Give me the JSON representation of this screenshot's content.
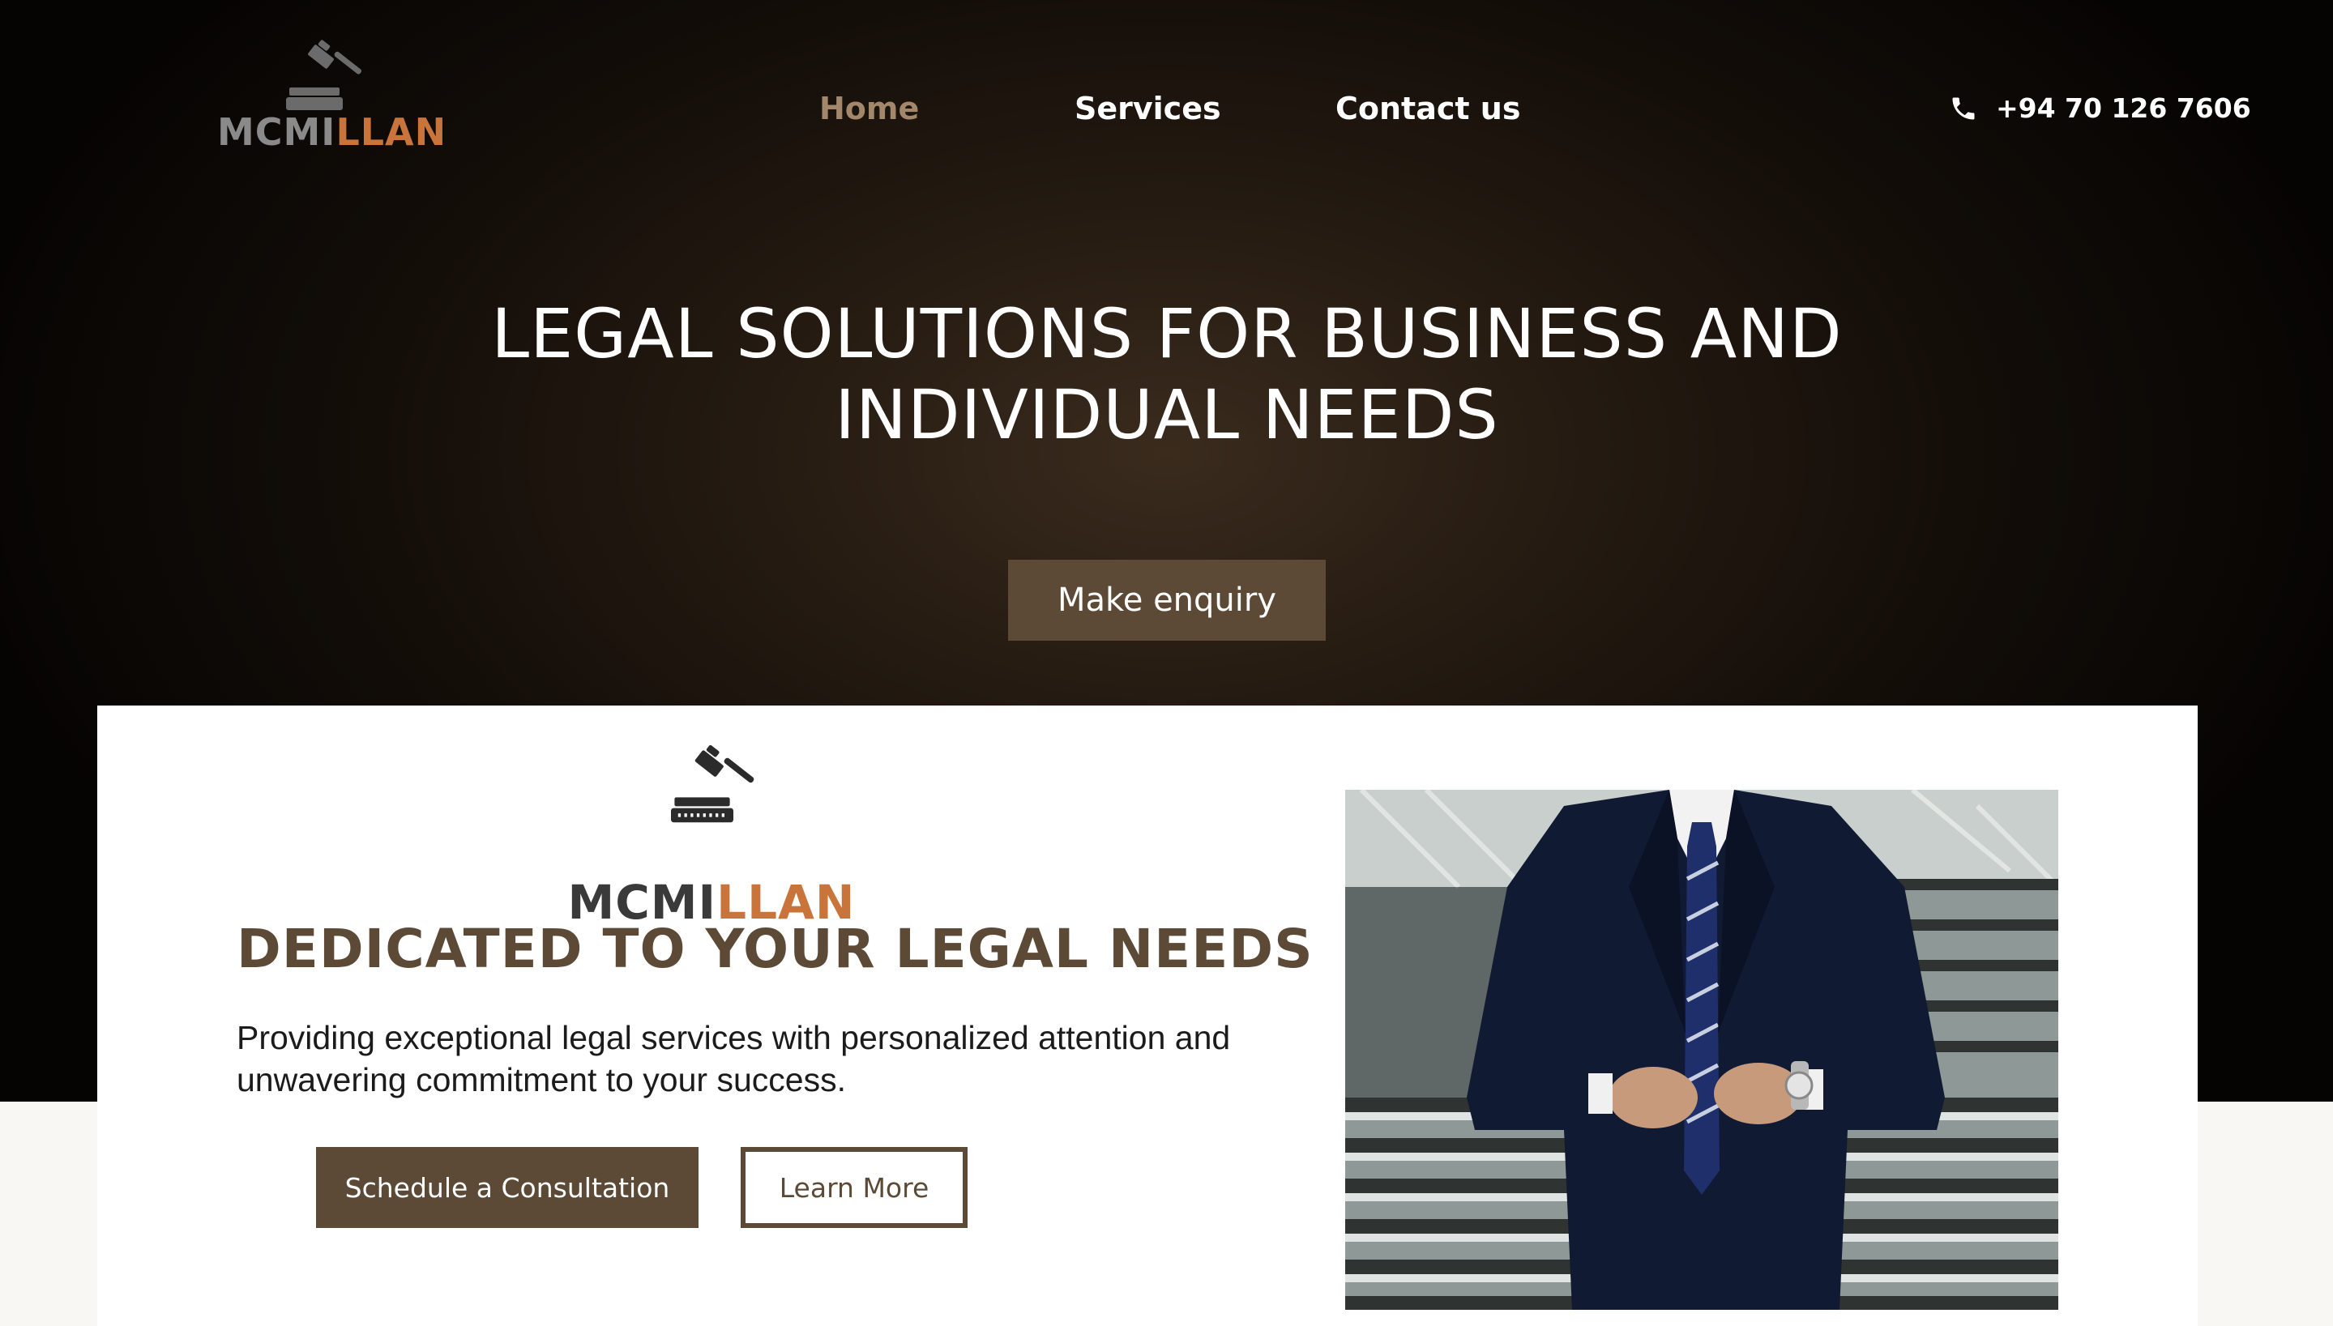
{
  "header": {
    "logo": {
      "part1": "MCMI",
      "part2": "LLAN",
      "icon": "gavel-icon"
    },
    "nav": [
      {
        "label": "Home",
        "active": true
      },
      {
        "label": "Services",
        "active": false
      },
      {
        "label": "Contact us",
        "active": false
      }
    ],
    "phone": {
      "icon": "phone-icon",
      "number": "+94 70 126 7606"
    }
  },
  "hero": {
    "title_line1": "LEGAL SOLUTIONS FOR BUSINESS AND",
    "title_line2": "INDIVIDUAL NEEDS",
    "cta_label": "Make enquiry"
  },
  "card": {
    "logo": {
      "part1": "MCMI",
      "part2": "LLAN",
      "icon": "gavel-icon"
    },
    "title": "DEDICATED TO YOUR LEGAL NEEDS",
    "text_line1": "Providing exceptional legal services with personalized attention and",
    "text_line2": "unwavering commitment to your success.",
    "primary_button": "Schedule a Consultation",
    "secondary_button": "Learn More",
    "photo": "businessman-in-suit-photo"
  },
  "colors": {
    "accent": "#5c4a37",
    "nav_active": "#a3876a",
    "logo_accent": "#c8743a",
    "hero_dark": "#0a0705"
  }
}
